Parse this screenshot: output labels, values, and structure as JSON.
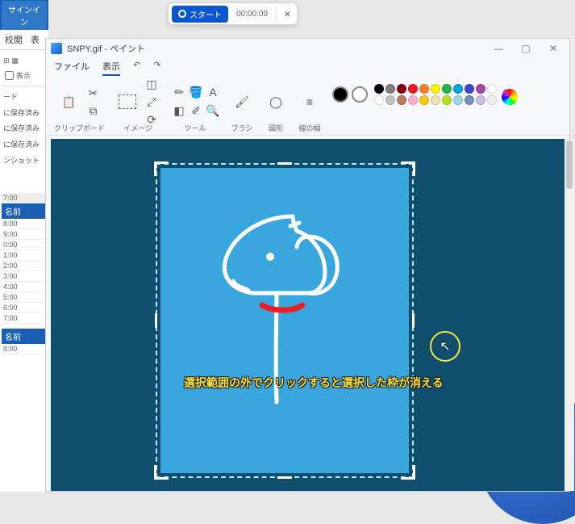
{
  "left_app": {
    "signin": "サインイン",
    "tabs": [
      "校閲",
      "表"
    ],
    "view_label": "表示",
    "side_items": [
      "ード",
      "に保存済み",
      "に保存済み",
      "に保存済み",
      "ンショット"
    ],
    "name_header": "名前",
    "times": [
      "7:00",
      "8:00",
      "9:00",
      "0:00",
      "1:00",
      "2:00",
      "3:00",
      "4:00",
      "5:00",
      "6:00",
      "7:00"
    ],
    "name_header2": "名前",
    "times2": [
      "8:00"
    ]
  },
  "recorder": {
    "start_label": "スタート",
    "time": "00:00:00",
    "close": "×"
  },
  "paint": {
    "title": "SNPY.gif - ペイント",
    "menu": {
      "file": "ファイル",
      "view": "表示",
      "undo": "↶",
      "redo": "↷"
    },
    "win": {
      "min": "—",
      "max": "▢",
      "close": "✕"
    },
    "groups": {
      "clipboard": "クリップボード",
      "image": "イメージ",
      "tool": "ツール",
      "brush": "ブラシ",
      "shapes": "図形",
      "stroke": "線の幅",
      "color": "色"
    },
    "palette": {
      "current": "#000000",
      "row1": [
        "#000000",
        "#7f7f7f",
        "#880015",
        "#ed1c24",
        "#ff7f27",
        "#fff200",
        "#22b14c",
        "#00a2e8",
        "#3f48cc",
        "#a349a4",
        "#ffffff"
      ],
      "row2": [
        "#ffffff",
        "#c3c3c3",
        "#b97a57",
        "#ffaec9",
        "#ffc90e",
        "#efe4b0",
        "#b5e61d",
        "#99d9ea",
        "#7092be",
        "#c8bfe7",
        "#f0f0f0"
      ]
    },
    "canvas_bg": "#104e6e",
    "selection_fill": "#39a6de",
    "annotation": "選択範囲の外でクリックすると選択した枠が消える",
    "cursor_icon": "↖"
  }
}
